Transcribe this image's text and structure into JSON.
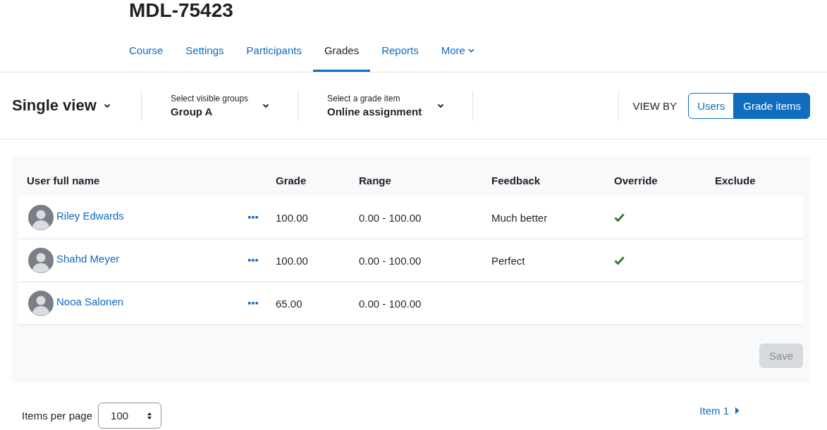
{
  "page_title": "MDL-75423",
  "tabs": [
    {
      "label": "Course",
      "selected": false,
      "dropdown": false
    },
    {
      "label": "Settings",
      "selected": false,
      "dropdown": false
    },
    {
      "label": "Participants",
      "selected": false,
      "dropdown": false
    },
    {
      "label": "Grades",
      "selected": true,
      "dropdown": false
    },
    {
      "label": "Reports",
      "selected": false,
      "dropdown": false
    },
    {
      "label": "More",
      "selected": false,
      "dropdown": true
    }
  ],
  "view_selector": {
    "label": "Single view"
  },
  "group_select": {
    "label": "Select visible groups",
    "value": "Group A"
  },
  "item_select": {
    "label": "Select a grade item",
    "value": "Online assignment"
  },
  "view_by": {
    "label": "VIEW BY",
    "options": [
      {
        "label": "Users",
        "selected": false
      },
      {
        "label": "Grade items",
        "selected": true
      }
    ]
  },
  "table": {
    "columns": [
      "User full name",
      "Grade",
      "Range",
      "Feedback",
      "Override",
      "Exclude"
    ],
    "rows": [
      {
        "name": "Riley Edwards",
        "grade": "100.00",
        "range": "0.00 - 100.00",
        "feedback": "Much better",
        "override": true
      },
      {
        "name": "Shahd Meyer",
        "grade": "100.00",
        "range": "0.00 - 100.00",
        "feedback": "Perfect",
        "override": true
      },
      {
        "name": "Nooa Salonen",
        "grade": "65.00",
        "range": "0.00 - 100.00",
        "feedback": "",
        "override": false
      }
    ]
  },
  "save_button": {
    "label": "Save",
    "disabled": true
  },
  "pagination": {
    "per_page_label": "Items per page",
    "per_page_value": "100",
    "next_label": "Item 1"
  }
}
